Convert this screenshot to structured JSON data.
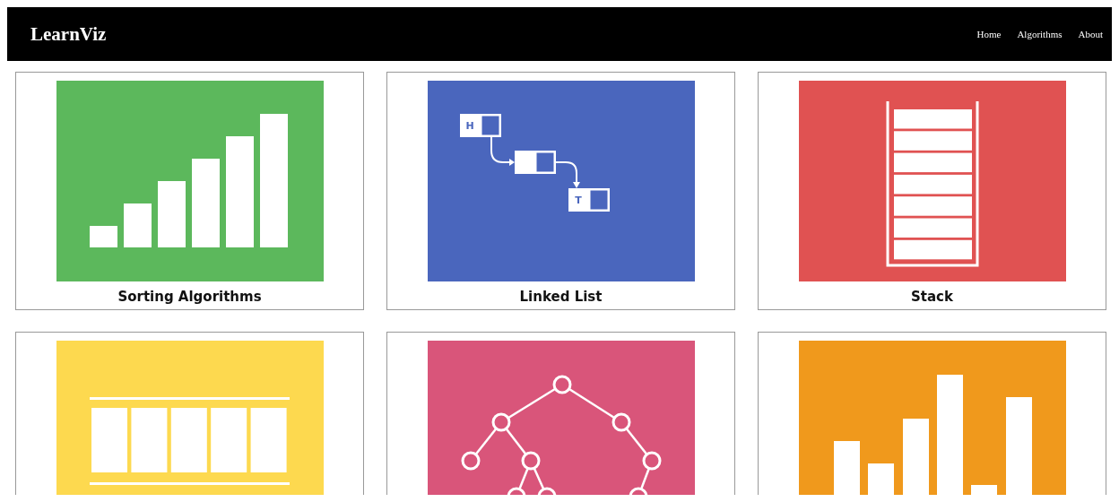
{
  "navbar": {
    "brand": "LearnViz",
    "links": [
      {
        "label": "Home"
      },
      {
        "label": "Algorithms"
      },
      {
        "label": "About"
      }
    ]
  },
  "cards": [
    {
      "kind": "sorted",
      "color": "#5cb85c",
      "title": "Sorting Algorithms"
    },
    {
      "kind": "linked",
      "color": "#4a66bd",
      "title": "Linked List",
      "labels": [
        "H",
        "T"
      ]
    },
    {
      "kind": "stack",
      "color": "#e05252",
      "title": "Stack"
    },
    {
      "kind": "queue",
      "color": "#fdd94f"
    },
    {
      "kind": "tree",
      "color": "#d9557a"
    },
    {
      "kind": "heap",
      "color": "#f0991c"
    }
  ]
}
